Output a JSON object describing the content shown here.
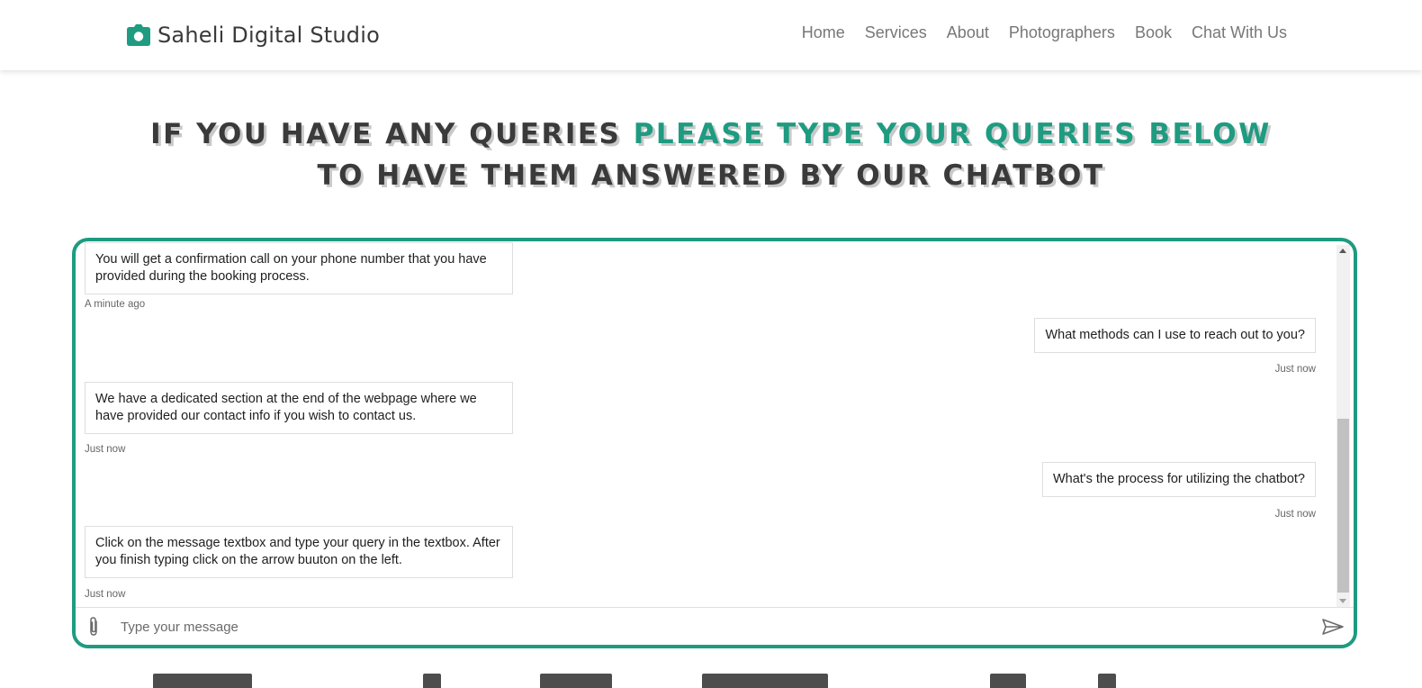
{
  "brand": {
    "name": "Saheli Digital Studio",
    "icon": "camera-icon"
  },
  "nav": {
    "items": [
      {
        "label": "Home"
      },
      {
        "label": "Services"
      },
      {
        "label": "About"
      },
      {
        "label": "Photographers"
      },
      {
        "label": "Book"
      },
      {
        "label": "Chat With Us"
      }
    ]
  },
  "headline": {
    "part1": "If you have any queries ",
    "accent": "please type your queries below",
    "part2": " to have them answered by our chatbot"
  },
  "chat": {
    "messages": [
      {
        "from": "bot",
        "text": "You will get a confirmation call on your phone number that you have provided during the booking process.",
        "time": "A minute ago"
      },
      {
        "from": "user",
        "text": "What methods can I use to reach out to you?",
        "time": "Just now"
      },
      {
        "from": "bot",
        "text": "We have a dedicated section at the end of the webpage where we have provided our contact info if you wish to contact us.",
        "time": "Just now"
      },
      {
        "from": "user",
        "text": "What's the process for utilizing the chatbot?",
        "time": "Just now"
      },
      {
        "from": "bot",
        "text": "Click on the message textbox and type your query in the textbox. After you finish typing click on the arrow buuton on the left.",
        "time": "Just now"
      }
    ],
    "input": {
      "placeholder": "Type your message",
      "value": ""
    },
    "attach_icon": "paperclip-icon",
    "send_icon": "send-arrow-icon"
  },
  "colors": {
    "accent": "#1e9b80",
    "heading": "#3a3a3a",
    "nav": "#777777"
  }
}
